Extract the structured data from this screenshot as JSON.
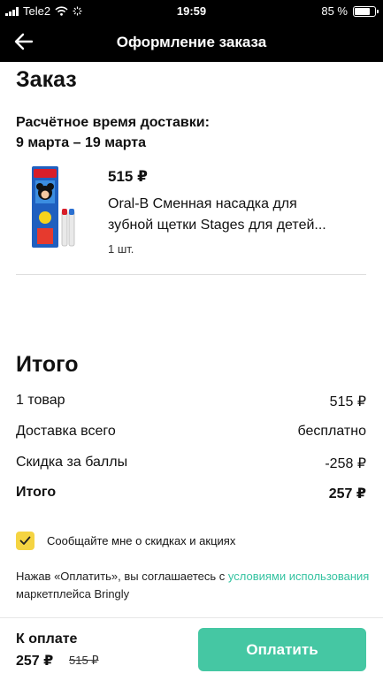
{
  "status_bar": {
    "carrier": "Tele2",
    "time": "19:59",
    "battery": "85 %",
    "battery_level": 0.85
  },
  "header": {
    "title": "Оформление заказа",
    "back_icon": "arrow-left-icon"
  },
  "order": {
    "title": "Заказ",
    "delivery_label": "Расчётное время доставки:",
    "delivery_dates": "9 марта – 19 марта",
    "item": {
      "price": "515 ₽",
      "name_line1": "Oral-B Сменная насадка для",
      "name_line2": "зубной щетки Stages для детей...",
      "quantity": "1 шт."
    }
  },
  "summary": {
    "title": "Итого",
    "rows": [
      {
        "label": "1 товар",
        "value": "515 ₽"
      },
      {
        "label": "Доставка всего",
        "value": "бесплатно"
      },
      {
        "label": "Скидка за баллы",
        "value": "-258 ₽"
      },
      {
        "label": "Итого",
        "value": "257 ₽"
      }
    ]
  },
  "subscribe": {
    "checked": true,
    "label": "Сообщайте мне о скидках и акциях"
  },
  "terms": {
    "text_before": "Нажав «Оплатить», вы соглашаетесь с ",
    "link_text": "условиями использования",
    "text_after": " маркетплейса Bringly"
  },
  "footer": {
    "pay_label": "К оплате",
    "total": "257 ₽",
    "old_total": "515 ₽",
    "pay_button": "Оплатить"
  },
  "colors": {
    "accent": "#45c7a3",
    "link": "#35c3a1",
    "checkbox": "#f5d442",
    "header_bg": "#000000"
  }
}
